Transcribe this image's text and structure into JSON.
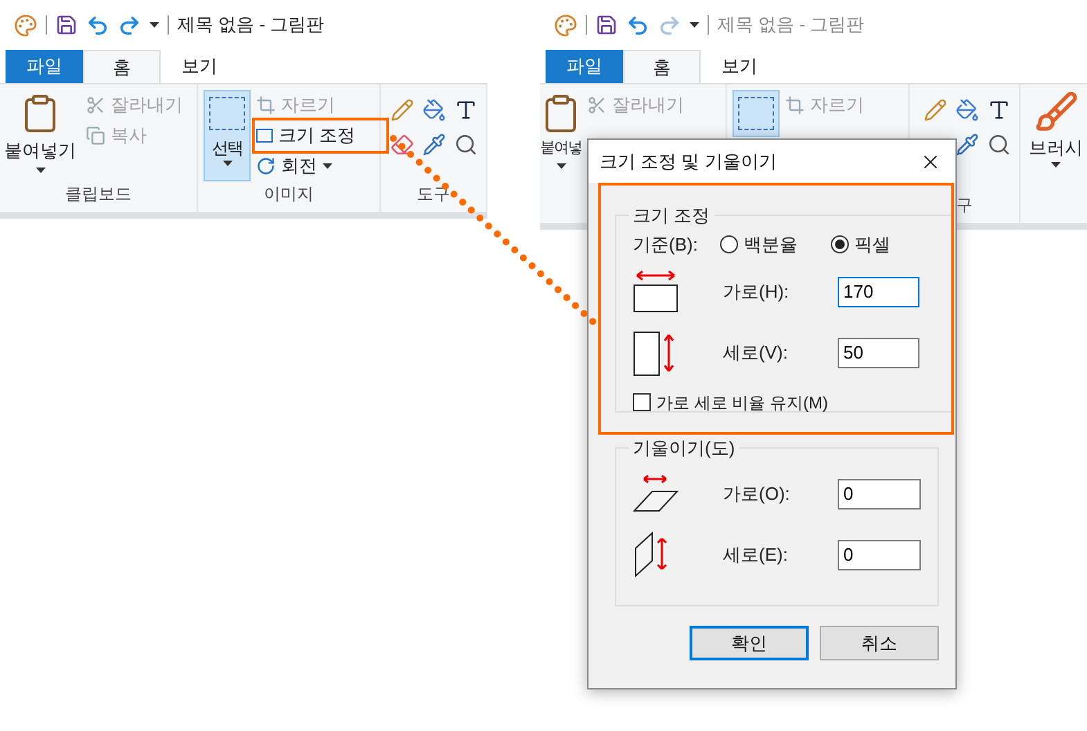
{
  "panels": [
    {
      "title": "제목 없음 - 그림판",
      "active": true,
      "tabs": [
        {
          "label": "파일",
          "kind": "file",
          "selected": false
        },
        {
          "label": "홈",
          "kind": "tab",
          "selected": true
        },
        {
          "label": "보기",
          "kind": "tab",
          "selected": false
        }
      ],
      "clipboard": {
        "paste": "붙여넣기",
        "cut": {
          "label": "잘라내기",
          "disabled": true
        },
        "copy": {
          "label": "복사",
          "disabled": true
        },
        "label": "클립보드"
      },
      "image": {
        "select": {
          "label": "선택",
          "selected": true
        },
        "crop": {
          "label": "자르기",
          "disabled": true
        },
        "resize": {
          "label": "크기 조정",
          "disabled": false
        },
        "rotate": {
          "label": "회전",
          "disabled": false
        },
        "label": "이미지"
      },
      "tools": {
        "rows": [
          [
            {
              "kind": "pencil"
            },
            {
              "kind": "fill"
            },
            {
              "kind": "text"
            }
          ],
          [
            {
              "kind": "eraser"
            },
            {
              "kind": "picker"
            },
            {
              "kind": "magnifier"
            }
          ]
        ],
        "label": "도구"
      }
    },
    {
      "title": "제목 없음 - 그림판",
      "active": false,
      "tabs": [
        {
          "label": "파일",
          "kind": "file",
          "selected": false
        },
        {
          "label": "홈",
          "kind": "tab",
          "selected": true
        },
        {
          "label": "보기",
          "kind": "tab",
          "selected": false
        }
      ],
      "clipboard": {
        "paste": "붙여넣",
        "cut": {
          "label": "잘라내기",
          "disabled": true
        }
      },
      "image": {
        "select": {
          "selected": true
        },
        "crop": {
          "label": "자르기",
          "disabled": true
        }
      },
      "tools": {
        "rows": [
          [
            {
              "kind": "pencil"
            },
            {
              "kind": "fill"
            },
            {
              "kind": "text"
            }
          ],
          [
            {
              "kind": "picker"
            },
            {
              "kind": "magnifier"
            }
          ]
        ],
        "label": "구"
      },
      "brush": {
        "label": "브러시"
      }
    }
  ],
  "dialog": {
    "title": "크기 조정 및 기울이기",
    "resize": {
      "legend": "크기 조정",
      "basis_label": "기준(B):",
      "options": [
        {
          "label": "백분율",
          "selected": false
        },
        {
          "label": "픽셀",
          "selected": true
        }
      ],
      "fields": [
        {
          "kind": "horizontal",
          "label": "가로(H):",
          "value": "170",
          "focused": true
        },
        {
          "kind": "vertical",
          "label": "세로(V):",
          "value": "50",
          "focused": false
        }
      ],
      "keep_ratio": {
        "label": "가로 세로 비율 유지(M)",
        "checked": false
      }
    },
    "skew": {
      "legend": "기울이기(도)",
      "fields": [
        {
          "kind": "horizontal",
          "label": "가로(O):",
          "value": "0"
        },
        {
          "kind": "vertical",
          "label": "세로(E):",
          "value": "0"
        }
      ]
    },
    "buttons": [
      {
        "label": "확인",
        "default": true
      },
      {
        "label": "취소",
        "default": false
      }
    ]
  }
}
